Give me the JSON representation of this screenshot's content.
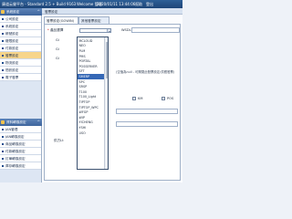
{
  "titlebar": {
    "title": "康道云營平台 - Standard 2.5 + Build 9163",
    "user": "Welcome 管理",
    "time": "2020/01/11 13:44:06",
    "help": "幫助",
    "logout": "登出"
  },
  "sidebar": {
    "sections": [
      {
        "title": "系統設定",
        "toggle": "^",
        "items": [
          {
            "label": "公司設定"
          },
          {
            "label": "系統設定"
          },
          {
            "label": "帳號設定"
          },
          {
            "label": "權限設定"
          },
          {
            "label": "付款設定"
          },
          {
            "label": "發票設定"
          },
          {
            "label": "物流設定"
          },
          {
            "label": "簡訊設定"
          },
          {
            "label": "電子發票"
          }
        ]
      },
      {
        "title": "資料轉換設定",
        "toggle": "^",
        "items": [
          {
            "label": "JAN管理"
          },
          {
            "label": "JAN轉換設定"
          },
          {
            "label": "商品轉換設定"
          },
          {
            "label": "付款轉換設定"
          },
          {
            "label": "訂單轉換設定"
          },
          {
            "label": "庫存轉換設定"
          }
        ]
      }
    ],
    "active_item": "發票設定"
  },
  "main": {
    "breadcrumb": "發票設定",
    "tabs": [
      {
        "label": "發票設定(GOWIN)"
      },
      {
        "label": "其他發票設定"
      }
    ],
    "product_label": "產品選擇",
    "required_mark": "*",
    "product_value": "",
    "wsdl_label": "WSDL",
    "wsdl_value": "",
    "hint_text": "(空值為null - 可關閉此發票設定/供應發票)",
    "checkbox_1_label": "KM",
    "checkbox_2_label": "POS",
    "left_labels": [
      "Gi",
      "Gi",
      "Gi",
      "供方Lt"
    ],
    "dropdown_options": [
      "MCLOUD",
      "NEO",
      "PLM",
      "PMS",
      "PORTAL",
      "POSSERVER",
      "SFT",
      "SMERP",
      "SPC",
      "SRSP",
      "T100",
      "T100_Light",
      "TIPTOP",
      "TIPTOP_WPC",
      "WFGP",
      "WIP",
      "YICHENG",
      "YSHI",
      "USO"
    ],
    "dropdown_selected": "SMERP"
  },
  "colors": {
    "titlebar": "#1d4578",
    "section_header": "#3e659d",
    "active_item": "#f7d58a",
    "selected_option": "#3568b6"
  }
}
